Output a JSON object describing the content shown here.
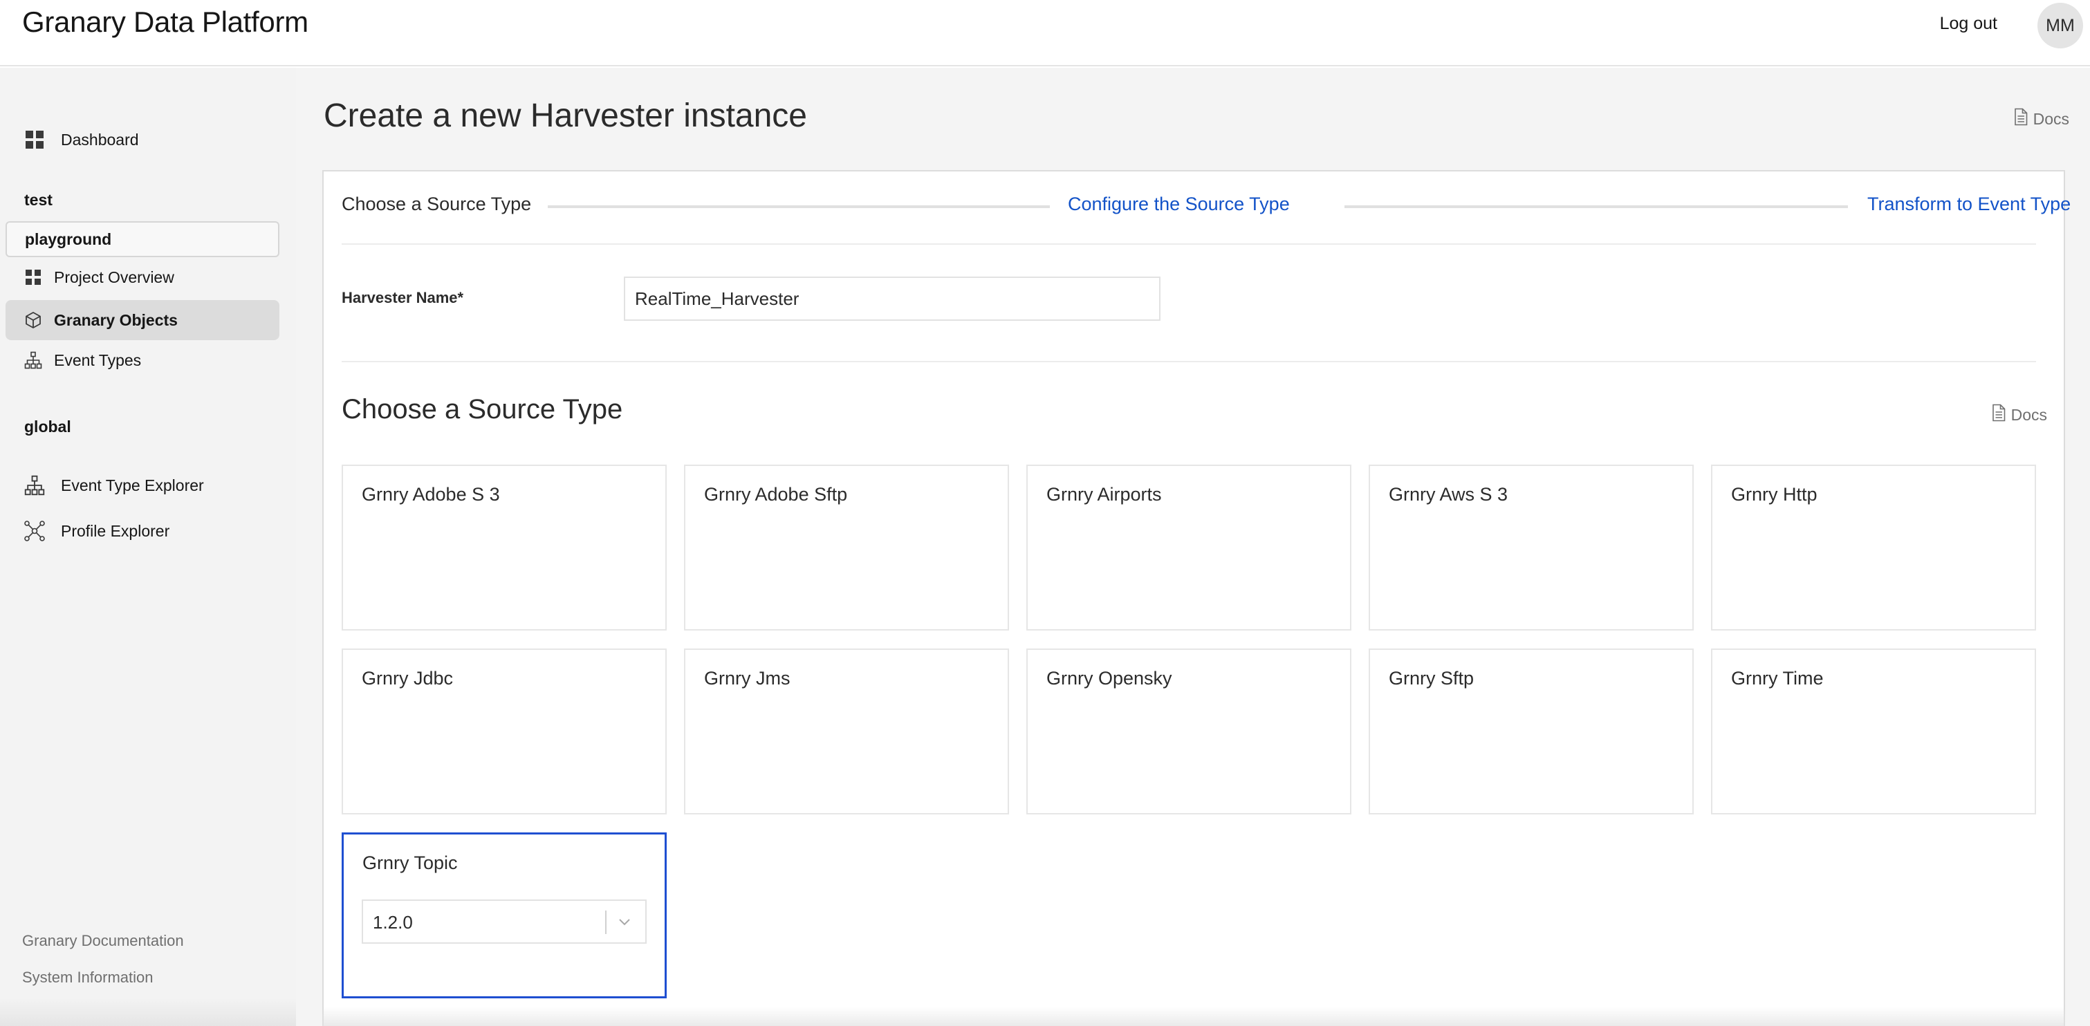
{
  "header": {
    "app_title": "Granary Data Platform",
    "logout_label": "Log out",
    "avatar_initials": "MM"
  },
  "sidebar": {
    "dashboard_label": "Dashboard",
    "section_test": "test",
    "project_name": "playground",
    "project_items": [
      {
        "label": "Project Overview",
        "icon": "grid-icon"
      },
      {
        "label": "Granary Objects",
        "icon": "cube-icon",
        "active": true
      },
      {
        "label": "Event Types",
        "icon": "hierarchy-icon"
      }
    ],
    "section_global": "global",
    "global_items": [
      {
        "label": "Event Type Explorer",
        "icon": "hierarchy-icon"
      },
      {
        "label": "Profile Explorer",
        "icon": "network-icon"
      }
    ],
    "footer": {
      "documentation": "Granary Documentation",
      "system_information": "System Information"
    }
  },
  "page": {
    "title": "Create a new Harvester instance",
    "docs_label": "Docs"
  },
  "wizard": {
    "steps": [
      {
        "label": "Choose a Source Type",
        "state": "current"
      },
      {
        "label": "Configure the Source Type",
        "state": "link"
      },
      {
        "label": "Transform to Event Type",
        "state": "link"
      }
    ]
  },
  "form": {
    "harvester_name_label": "Harvester Name*",
    "harvester_name_value": "RealTime_Harvester"
  },
  "source_types": {
    "title": "Choose a Source Type",
    "docs_label": "Docs",
    "tiles": [
      "Grnry Adobe S 3",
      "Grnry Adobe Sftp",
      "Grnry Airports",
      "Grnry Aws S 3",
      "Grnry Http",
      "Grnry Jdbc",
      "Grnry Jms",
      "Grnry Opensky",
      "Grnry Sftp",
      "Grnry Time",
      "Grnry Topic"
    ],
    "selected": "Grnry Topic",
    "selected_version": "1.2.0"
  },
  "colors": {
    "accent": "#1f4fd1",
    "link": "#1353c8",
    "sidebar_bg": "#f3f3f3",
    "active_item_bg": "#dcdcdc"
  }
}
